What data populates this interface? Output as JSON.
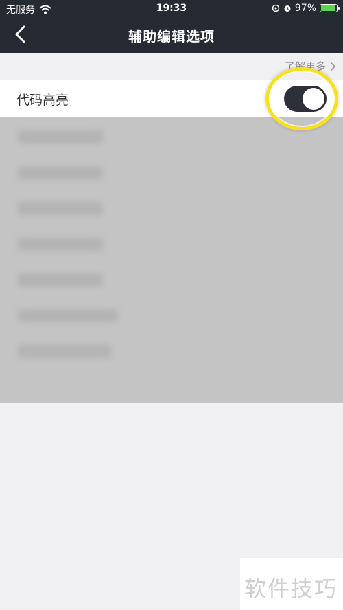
{
  "status_bar": {
    "carrier": "无服务",
    "time": "19:33",
    "battery_percent": "97%",
    "battery_level": 0.97,
    "icons": [
      "wifi-icon",
      "location-icon",
      "alarm-icon",
      "battery-charging-icon"
    ]
  },
  "nav": {
    "title": "辅助编辑选项",
    "back_icon": "chevron-left-icon"
  },
  "header_link": {
    "label": "了解更多",
    "icon": "chevron-right-icon"
  },
  "setting": {
    "label": "代码高亮",
    "toggle_on": true
  },
  "watermark": {
    "text": "软件技巧"
  },
  "colors": {
    "header_bg": "#262a33",
    "page_bg": "#f0f0f2",
    "toggle_on": "#2e3039",
    "highlight": "#f5e11e",
    "blur_panel": "#c4c4c4"
  }
}
